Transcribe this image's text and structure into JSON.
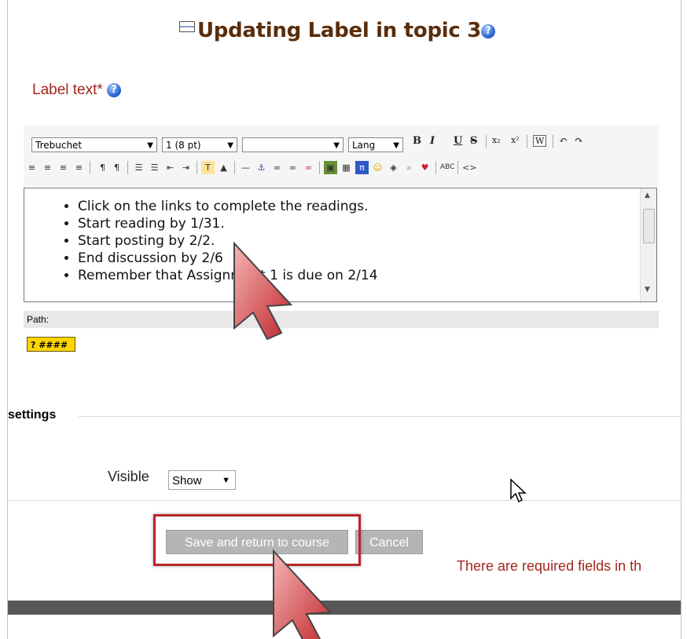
{
  "page": {
    "title": "Updating Label in topic 3",
    "help_glyph": "?"
  },
  "label_field": {
    "label": "Label text*"
  },
  "editor": {
    "font_family_value": "Trebuchet",
    "font_size_value": "1 (8 pt)",
    "format_value": "",
    "lang_label": "Lang",
    "toolbar_icons": [
      "bold-icon",
      "italic-icon",
      "underline-icon",
      "strikethrough-icon",
      "subscript-icon",
      "superscript-icon",
      "paste-word-icon",
      "undo-icon",
      "redo-icon"
    ],
    "content": [
      "Click on the links to complete the readings.",
      "Start reading by 1/31.",
      "Start posting by 2/2.",
      "End discussion by 2/6",
      "Remember that Assignment 1 is due on 2/14"
    ],
    "path_label": "Path:",
    "keyboard_help_label": "? ####"
  },
  "settings_section": {
    "title": "settings",
    "visible_label": "Visible",
    "visible_value": "Show"
  },
  "actions": {
    "save_label": "Save and return to course",
    "cancel_label": "Cancel"
  },
  "messages": {
    "required": "There are required fields in th"
  }
}
